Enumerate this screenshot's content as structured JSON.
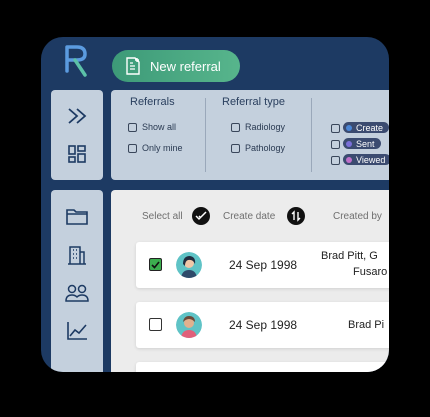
{
  "header": {
    "new_referral_label": "New referral"
  },
  "filters": {
    "referrals": {
      "title": "Referrals",
      "options": [
        "Show all",
        "Only mine"
      ]
    },
    "referral_type": {
      "title": "Referral type",
      "options": [
        "Radiology",
        "Pathology"
      ]
    },
    "status": [
      {
        "label": "Create",
        "color": "#4b86d6"
      },
      {
        "label": "Sent",
        "color": "#7a6fd8"
      },
      {
        "label": "Viewed",
        "color": "#c06fc9"
      }
    ]
  },
  "table": {
    "select_all_label": "Select all",
    "create_date_label": "Create date",
    "created_by_label": "Created by",
    "rows": [
      {
        "checked": true,
        "date": "24 Sep 1998",
        "created_by_line1": "Brad Pitt, G",
        "created_by_line2": "Fusaro"
      },
      {
        "checked": false,
        "date": "24 Sep 1998",
        "created_by_line1": "Brad Pi",
        "created_by_line2": ""
      }
    ]
  },
  "colors": {
    "sidebar_bg": "#1d3a63",
    "panel_bg": "#c4d0dd",
    "accent_green": "#4fab82"
  }
}
